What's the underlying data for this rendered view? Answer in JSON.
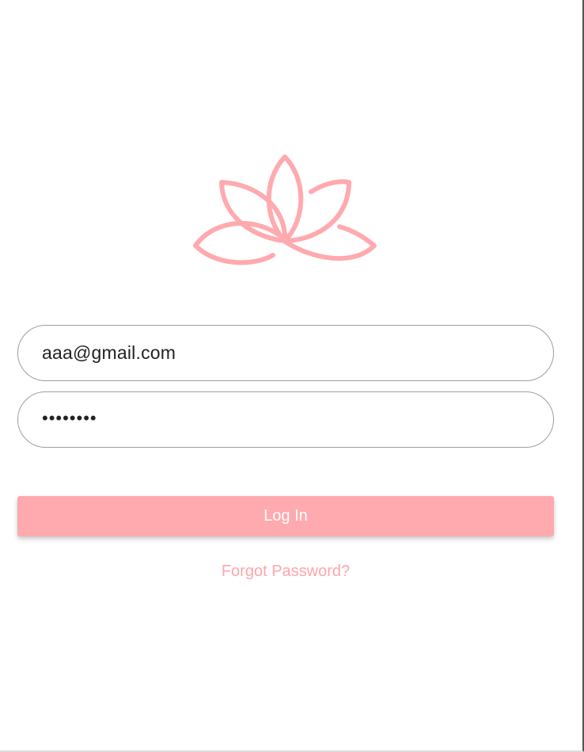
{
  "theme": {
    "accent": "#ffaaaf",
    "logo_color": "#ffaaaf",
    "link_color": "#ffa5ac"
  },
  "logo": {
    "icon": "lotus-icon"
  },
  "form": {
    "email_value": "aaa@gmail.com",
    "password_value": "••••••••"
  },
  "actions": {
    "login_label": "Log In",
    "forgot_label": "Forgot Password?"
  }
}
